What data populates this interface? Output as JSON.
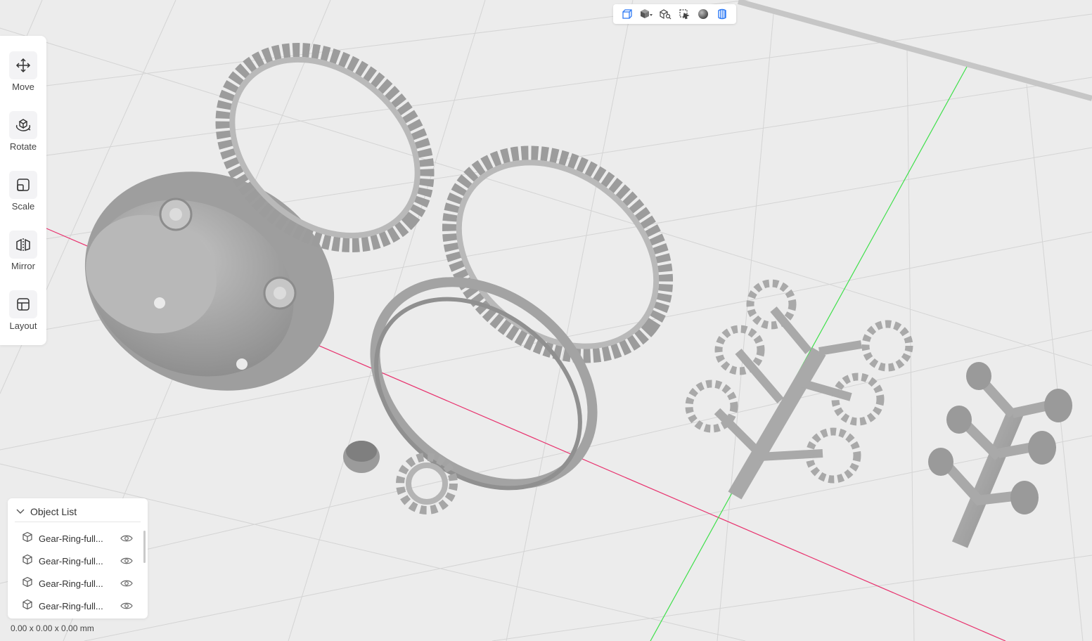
{
  "view_toolbar": {
    "icons": [
      "wireframe-cube-icon",
      "solid-cube-dropdown-icon",
      "cube-search-icon",
      "select-cursor-icon",
      "sphere-shading-icon",
      "layers-view-icon"
    ]
  },
  "tools": [
    {
      "label": "Move",
      "icon": "move-icon"
    },
    {
      "label": "Rotate",
      "icon": "rotate-icon"
    },
    {
      "label": "Scale",
      "icon": "scale-icon"
    },
    {
      "label": "Mirror",
      "icon": "mirror-icon"
    },
    {
      "label": "Layout",
      "icon": "layout-icon"
    }
  ],
  "object_list": {
    "title": "Object List",
    "items": [
      {
        "name": "Gear-Ring-full..."
      },
      {
        "name": "Gear-Ring-full..."
      },
      {
        "name": "Gear-Ring-full..."
      },
      {
        "name": "Gear-Ring-full..."
      }
    ]
  },
  "status": {
    "dimensions": "0.00 x 0.00 x 0.00 mm"
  },
  "colors": {
    "accent": "#2f7bf5",
    "x_axis": "#e8326e",
    "y_axis": "#3ee04a",
    "model": "#a9a9a9",
    "grid": "#d2d2d2"
  }
}
